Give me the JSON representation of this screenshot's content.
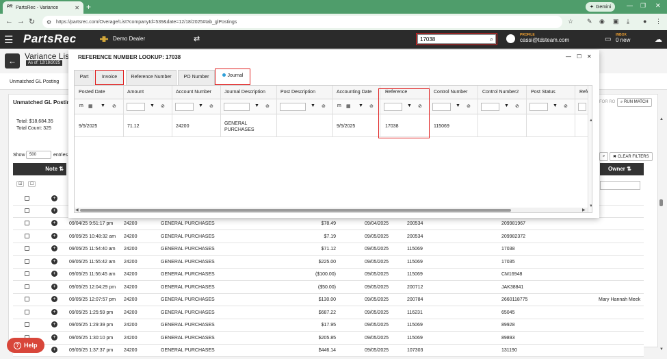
{
  "browser": {
    "tab_title": "PartsRec - Variance",
    "favicon_text": "PR",
    "url": "https://partsrec.com/Overage/List?companyId=539&date=12/18/2025#tab_glPostings",
    "gemini_label": "Gemini"
  },
  "header": {
    "logo": "PartsRec",
    "dealer": "Demo Dealer",
    "search_value": "17038",
    "profile_label": "PROFILE",
    "profile_email": "cassi@tdsteam.com",
    "inbox_label": "INBOX",
    "inbox_value": "0 new"
  },
  "page": {
    "title": "Variance List",
    "as_of": "As of: 12/18/2025",
    "bg_tab": "Unmatched GL Posting",
    "panel_title": "Unmatched GL Posting",
    "total": "Total: $18,684.35",
    "total_count": "Total Count: 325",
    "show_label": "Show",
    "show_value": "500",
    "entries_label": "entries",
    "note_header": "Note",
    "owner_header": "Owner",
    "for_ro": "FOR RO",
    "run_match": "RUN MATCH",
    "clear_filters": "CLEAR FILTERS",
    "help": "Help"
  },
  "bg_rows": [
    {
      "posted": "09/04/25 9:51:17 pm",
      "acct": "24200",
      "desc": "GENERAL PURCHASES",
      "amount": "$78.49",
      "date": "09/04/2025",
      "ref": "200534",
      "ctrl": "209981967",
      "owner": ""
    },
    {
      "posted": "09/05/25 10:48:32 am",
      "acct": "24200",
      "desc": "GENERAL PURCHASES",
      "amount": "$7.19",
      "date": "09/05/2025",
      "ref": "200534",
      "ctrl": "209982372",
      "owner": ""
    },
    {
      "posted": "09/05/25 11:54:40 am",
      "acct": "24200",
      "desc": "GENERAL PURCHASES",
      "amount": "$71.12",
      "date": "09/05/2025",
      "ref": "115069",
      "ctrl": "17038",
      "owner": ""
    },
    {
      "posted": "09/05/25 11:55:42 am",
      "acct": "24200",
      "desc": "GENERAL PURCHASES",
      "amount": "$225.00",
      "date": "09/05/2025",
      "ref": "115069",
      "ctrl": "17035",
      "owner": ""
    },
    {
      "posted": "09/05/25 11:56:45 am",
      "acct": "24200",
      "desc": "GENERAL PURCHASES",
      "amount": "($100.00)",
      "date": "09/05/2025",
      "ref": "115069",
      "ctrl": "CM16948",
      "owner": ""
    },
    {
      "posted": "09/05/25 12:04:29 pm",
      "acct": "24200",
      "desc": "GENERAL PURCHASES",
      "amount": "($50.00)",
      "date": "09/05/2025",
      "ref": "200712",
      "ctrl": "JAK38841",
      "owner": ""
    },
    {
      "posted": "09/05/25 12:07:57 pm",
      "acct": "24200",
      "desc": "GENERAL PURCHASES",
      "amount": "$130.00",
      "date": "09/05/2025",
      "ref": "200784",
      "ctrl": "2660118775",
      "owner": "Mary Hannah Meek"
    },
    {
      "posted": "09/05/25 1:25:59 pm",
      "acct": "24200",
      "desc": "GENERAL PURCHASES",
      "amount": "$687.22",
      "date": "09/05/2025",
      "ref": "116231",
      "ctrl": "65045",
      "owner": ""
    },
    {
      "posted": "09/05/25 1:29:39 pm",
      "acct": "24200",
      "desc": "GENERAL PURCHASES",
      "amount": "$17.95",
      "date": "09/05/2025",
      "ref": "115069",
      "ctrl": "89928",
      "owner": ""
    },
    {
      "posted": "09/05/25 1:30:10 pm",
      "acct": "24200",
      "desc": "GENERAL PURCHASES",
      "amount": "$205.85",
      "date": "09/05/2025",
      "ref": "115069",
      "ctrl": "89893",
      "owner": ""
    },
    {
      "posted": "09/05/25 1:37:37 pm",
      "acct": "24200",
      "desc": "GENERAL PURCHASES",
      "amount": "$446.14",
      "date": "09/05/2025",
      "ref": "107303",
      "ctrl": "131190",
      "owner": ""
    }
  ],
  "modal": {
    "title": "REFERENCE NUMBER LOOKUP: 17038",
    "tabs": [
      {
        "label": "Part"
      },
      {
        "label": "Invoice"
      },
      {
        "label": "Reference Number"
      },
      {
        "label": "PO Number"
      },
      {
        "label": "Journal"
      }
    ],
    "columns": [
      "Posted Date",
      "Amount",
      "Account Number",
      "Journal Description",
      "Post Description",
      "Accounting Date",
      "Reference",
      "Control Number",
      "Control Number2",
      "Post Status",
      "Refe"
    ],
    "row": {
      "posted_date": "9/5/2025",
      "amount": "71.12",
      "account_number": "24200",
      "journal_desc_1": "GENERAL",
      "journal_desc_2": "PURCHASES",
      "post_description": "",
      "accounting_date": "9/5/2025",
      "reference": "17038",
      "control_number": "115069",
      "control_number2": "",
      "post_status": ""
    }
  }
}
